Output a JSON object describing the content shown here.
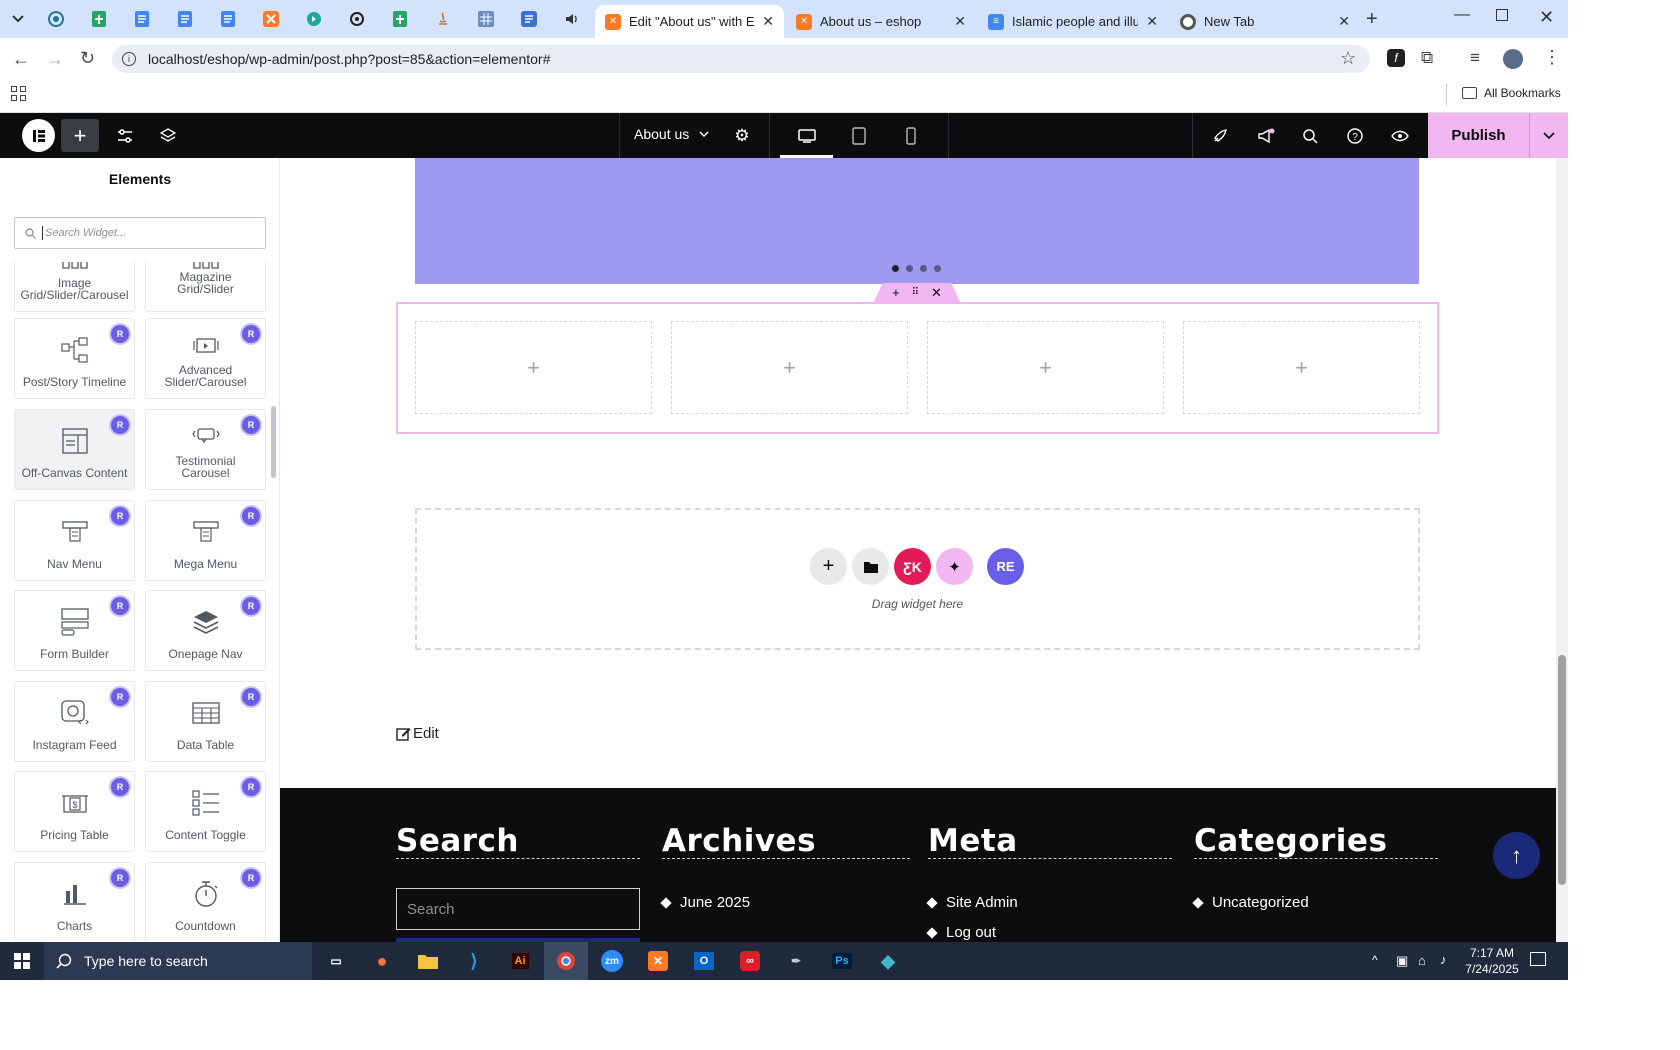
{
  "browser": {
    "tabs": [
      {
        "title": "Edit \"About us\" with Elem",
        "active": true,
        "icon": "elementor-icon"
      },
      {
        "title": "About us – eshop",
        "active": false,
        "icon": "elementor-icon"
      },
      {
        "title": "Islamic people and illustr",
        "active": false,
        "icon": "docs-icon"
      },
      {
        "title": "New Tab",
        "active": false,
        "icon": "chrome-icon"
      }
    ],
    "url": "localhost/eshop/wp-admin/post.php?post=85&action=elementor#",
    "bookmarks_label": "All Bookmarks"
  },
  "editor": {
    "page_title": "About us",
    "publish_label": "Publish"
  },
  "panel": {
    "title": "Elements",
    "search_placeholder": "Search Widget...",
    "badge": "R",
    "widgets": [
      {
        "label": "Image Grid/Slider/Carousel",
        "icon": "image-grid-icon",
        "badge": false
      },
      {
        "label": "Magazine Grid/Slider",
        "icon": "magazine-grid-icon",
        "badge": false
      },
      {
        "label": "Post/Story Timeline",
        "icon": "timeline-icon",
        "badge": true
      },
      {
        "label": "Advanced Slider/Carousel",
        "icon": "slider-icon",
        "badge": true
      },
      {
        "label": "Off-Canvas Content",
        "icon": "off-canvas-icon",
        "badge": true
      },
      {
        "label": "Testimonial Carousel",
        "icon": "testimonial-icon",
        "badge": true
      },
      {
        "label": "Nav Menu",
        "icon": "nav-menu-icon",
        "badge": true
      },
      {
        "label": "Mega Menu",
        "icon": "mega-menu-icon",
        "badge": true
      },
      {
        "label": "Form Builder",
        "icon": "form-icon",
        "badge": true
      },
      {
        "label": "Onepage Nav",
        "icon": "layers-icon",
        "badge": true
      },
      {
        "label": "Instagram Feed",
        "icon": "instagram-icon",
        "badge": true
      },
      {
        "label": "Data Table",
        "icon": "table-icon",
        "badge": true
      },
      {
        "label": "Pricing Table",
        "icon": "pricing-icon",
        "badge": true
      },
      {
        "label": "Content Toggle",
        "icon": "toggle-icon",
        "badge": true
      },
      {
        "label": "Charts",
        "icon": "charts-icon",
        "badge": true
      },
      {
        "label": "Countdown",
        "icon": "countdown-icon",
        "badge": true
      }
    ]
  },
  "canvas": {
    "drag_label": "Drag widget here",
    "edit_label": "Edit",
    "plus": "+",
    "footer": {
      "search": {
        "heading": "Search",
        "placeholder": "Search"
      },
      "archives": {
        "heading": "Archives",
        "items": [
          "June 2025"
        ]
      },
      "meta": {
        "heading": "Meta",
        "items": [
          "Site Admin",
          "Log out"
        ]
      },
      "categories": {
        "heading": "Categories",
        "items": [
          "Uncategorized"
        ]
      }
    }
  },
  "taskbar": {
    "search_placeholder": "Type here to search",
    "time": "7:17 AM",
    "date": "7/24/2025"
  },
  "colors": {
    "accent_purple": "#9e99ee",
    "publish_pink": "#f0b7f0",
    "elementor_black": "#0c0d0e",
    "badge": "#6a5de8"
  }
}
